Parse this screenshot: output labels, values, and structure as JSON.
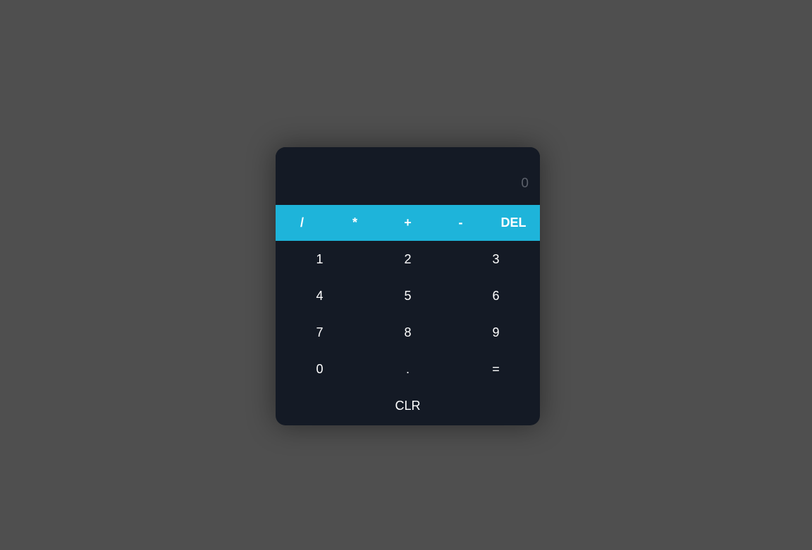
{
  "display": {
    "value": "0"
  },
  "operators": [
    "/",
    "*",
    "+",
    "-",
    "DEL"
  ],
  "keys": [
    "1",
    "2",
    "3",
    "4",
    "5",
    "6",
    "7",
    "8",
    "9",
    "0",
    ".",
    "="
  ],
  "clear_label": "CLR",
  "colors": {
    "background": "#4f4f4f",
    "calculator": "#141a25",
    "operator_bar": "#1eb4da",
    "display_text": "#5c616b",
    "key_text": "#ffffff"
  }
}
